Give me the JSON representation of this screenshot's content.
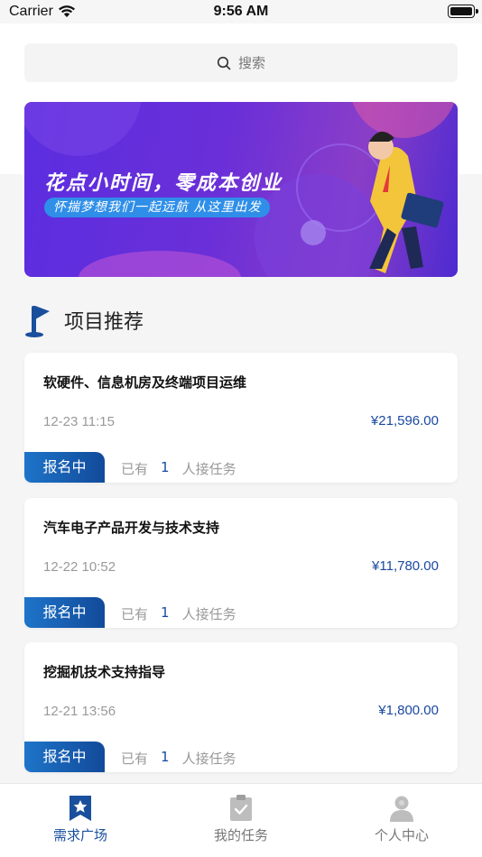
{
  "status_bar": {
    "carrier": "Carrier",
    "time": "9:56 AM"
  },
  "search": {
    "placeholder": "搜索"
  },
  "banner": {
    "headline": "花点小时间，零成本创业",
    "subline": "怀揣梦想我们一起远航 从这里出发"
  },
  "section": {
    "title": "项目推荐"
  },
  "projects": [
    {
      "title": "软硬件、信息机房及终端项目运维",
      "date": "12-23 11:15",
      "price": "¥21,596.00",
      "status": "报名中",
      "takers_prefix": "已有",
      "takers_count": "1",
      "takers_suffix": "人接任务"
    },
    {
      "title": "汽车电子产品开发与技术支持",
      "date": "12-22 10:52",
      "price": "¥11,780.00",
      "status": "报名中",
      "takers_prefix": "已有",
      "takers_count": "1",
      "takers_suffix": "人接任务"
    },
    {
      "title": "挖掘机技术支持指导",
      "date": "12-21 13:56",
      "price": "¥1,800.00",
      "status": "报名中",
      "takers_prefix": "已有",
      "takers_count": "1",
      "takers_suffix": "人接任务"
    }
  ],
  "tabbar": {
    "tabs": [
      {
        "label": "需求广场",
        "icon": "star-bookmark-icon",
        "active": true
      },
      {
        "label": "我的任务",
        "icon": "clipboard-check-icon",
        "active": false
      },
      {
        "label": "个人中心",
        "icon": "user-icon",
        "active": false
      }
    ]
  },
  "colors": {
    "accent": "#1a4f9c",
    "price": "#1a49a0",
    "banner_purple": "#5b2ee0"
  }
}
